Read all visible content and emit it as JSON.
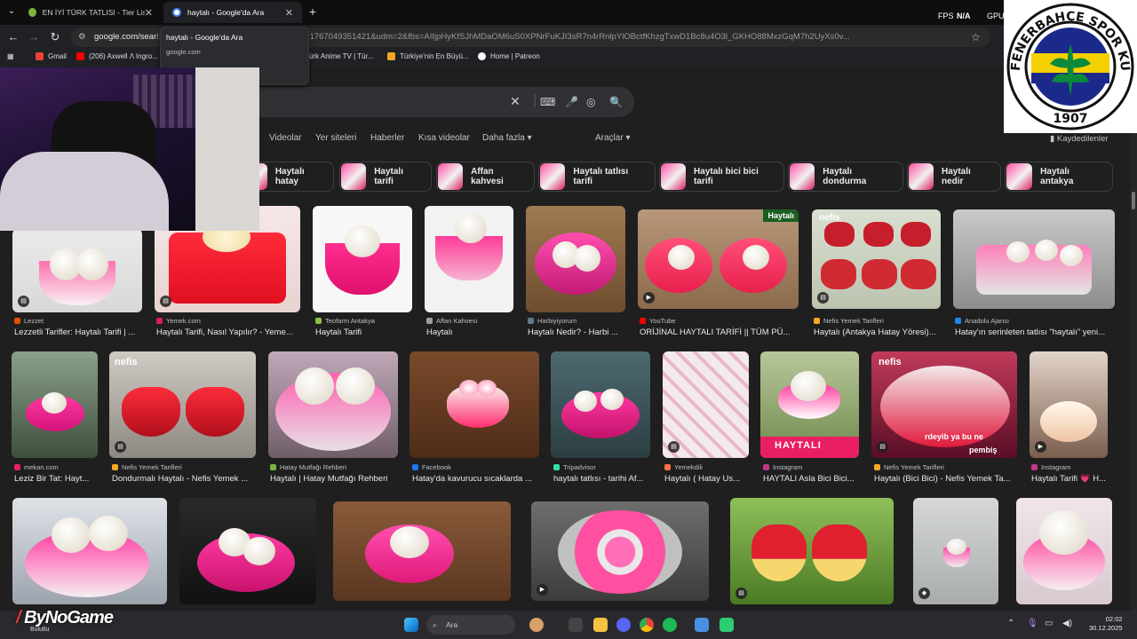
{
  "tabs": [
    {
      "title": "EN İYİ TÜRK TATLISI - Tier List, ...",
      "active": false
    },
    {
      "title": "haytalı - Google'da Ara",
      "active": true
    }
  ],
  "overlay_stats": {
    "fps_label": "FPS",
    "fps_value": "N/A",
    "gpu_label": "GPU"
  },
  "toolbar": {
    "url_host": "google.com/sear",
    "url_rest": "l:TifNuUFblw0XnkjGg2cKQBFlV31bbRw:1767049351421&udm=2&fbs=AIIjpHyKfSJhMDaOM6uS0XPNrFuKJI3sR7n4rRnlpYlOBctfKhzgTxwD1Bc8u4O3l_GKHO88MxzGqM7h2UyXs0v..."
  },
  "tooltip": {
    "title": "haytalı - Google'da Ara",
    "subtitle": "google.com"
  },
  "bookmarks": [
    {
      "label": "Gmail",
      "color": "#ea4335"
    },
    {
      "label": "(206) Axwell Λ Ingro...",
      "color": "#ff0000"
    },
    {
      "label": "ürk Anime TV | Tür...",
      "color": "#999999"
    },
    {
      "label": "Türkiye'nin En Büyü...",
      "color": "#f5a623"
    },
    {
      "label": "Home | Patreon",
      "color": "#ffffff"
    }
  ],
  "nav_tabs": [
    "Videolar",
    "Yer siteleri",
    "Haberler",
    "Kısa videolar",
    "Daha fazla ▾",
    "Araçlar ▾"
  ],
  "saved_label": "Kaydedilenler",
  "chips": [
    "Haytalı hatay",
    "Haytalı tarifi",
    "Affan kahvesi",
    "Haytalı tatlısı tarifi",
    "Haytalı bici bici tarifi",
    "Haytalı dondurma",
    "Haytalı nedir",
    "Haytalı antakya"
  ],
  "row1": [
    {
      "source": "Lezzet",
      "title": "Lezzetli Tarifler: Haytalı Tarifi | ...",
      "badge": "recipe"
    },
    {
      "source": "Yemek.com",
      "title": "Haytalı Tarifi, Nasıl Yapılır? - Yeme...",
      "badge": "recipe"
    },
    {
      "source": "Teofarm Antakya",
      "title": "Haytalı Tarifi",
      "badge": ""
    },
    {
      "source": "Affan Kahvesi",
      "title": "Haytalı",
      "badge": ""
    },
    {
      "source": "Harbiyiyorum",
      "title": "Haytalı Nedir? - Harbi ...",
      "badge": ""
    },
    {
      "source": "YouTube",
      "title": "ORİJİNAL HAYTALI TARİFİ || TÜM PÜ...",
      "badge": "video",
      "tag": "Haytalı"
    },
    {
      "source": "Nefis Yemek Tarifleri",
      "title": "Haytalı (Antakya Hatay Yöresi)...",
      "badge": "recipe",
      "tag": "nefis"
    },
    {
      "source": "Anadolu Ajansı",
      "title": "Hatay'ın serinleten tatlısı \"haytalı\" yeni...",
      "badge": ""
    }
  ],
  "row2": [
    {
      "source": "mekan.com",
      "title": "Leziz Bir Tat: Hayt...",
      "badge": ""
    },
    {
      "source": "Nefis Yemek Tarifleri",
      "title": "Dondurmalı Haytalı - Nefis Yemek ...",
      "badge": "recipe",
      "tag": "nefis"
    },
    {
      "source": "Hatay Mutfağı Rehberi",
      "title": "Haytalı | Hatay Mutfağı Rehberi",
      "badge": ""
    },
    {
      "source": "Facebook",
      "title": "Hatay'da kavurucu sıcaklarda ...",
      "badge": ""
    },
    {
      "source": "Tripadvisor",
      "title": "haytalı tatlısı - tarihi Af...",
      "badge": ""
    },
    {
      "source": "Yemekdili",
      "title": "Haytalı ( Hatay Us...",
      "badge": "recipe"
    },
    {
      "source": "Instagram",
      "title": "HAYTALI Asla Bici Bici...",
      "badge": "",
      "tag": "HAYTALI"
    },
    {
      "source": "Nefis Yemek Tarifleri",
      "title": "Haytalı (Bici Bici) - Nefis Yemek Ta...",
      "badge": "recipe",
      "tag": "nefis",
      "caption": "rdeyib ya bu ne",
      "caption2": "pembiş"
    },
    {
      "source": "Instagram",
      "title": "Haytalı Tarifi 💗 H...",
      "badge": "video"
    }
  ],
  "row3_badges": [
    "",
    "",
    "",
    "video",
    "recipe",
    "",
    "img"
  ],
  "taskbar": {
    "search": "Ara",
    "time": "02:02",
    "date": "30.12.2025"
  },
  "brand": {
    "name": "ByNoGame",
    "sub": "Bulutlu"
  },
  "logo": {
    "text": "FENERBAHÇE SPOR KULÜBÜ",
    "year": "1907"
  }
}
